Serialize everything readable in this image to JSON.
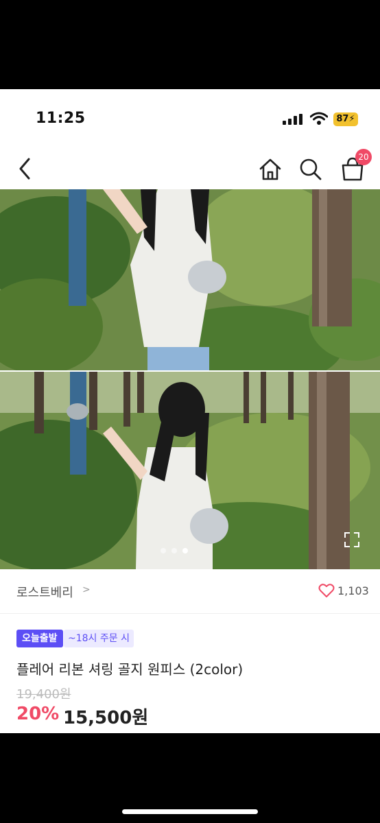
{
  "status_bar": {
    "time": "11:25",
    "battery": "87"
  },
  "nav": {
    "cart_badge": "20",
    "back_icon": "chevron-left-icon",
    "home_icon": "home-icon",
    "search_icon": "search-icon",
    "cart_icon": "shopping-bag-icon"
  },
  "gallery": {
    "slide_count": 3,
    "active_slide": 3
  },
  "store": {
    "name": "로스트베리",
    "like_count": "1,103"
  },
  "product": {
    "badge_delivery": "오늘출발",
    "badge_cutoff": "~18시 주문 시",
    "title": "플레어 리본 셔링 골지 원피스 (2color)",
    "original_price": "19,400원",
    "discount": "20%",
    "sale_price": "15,500원"
  },
  "colors": {
    "accent": "#5c4ef5",
    "discount": "#f04a66",
    "badge_battery": "#f2c12e"
  }
}
